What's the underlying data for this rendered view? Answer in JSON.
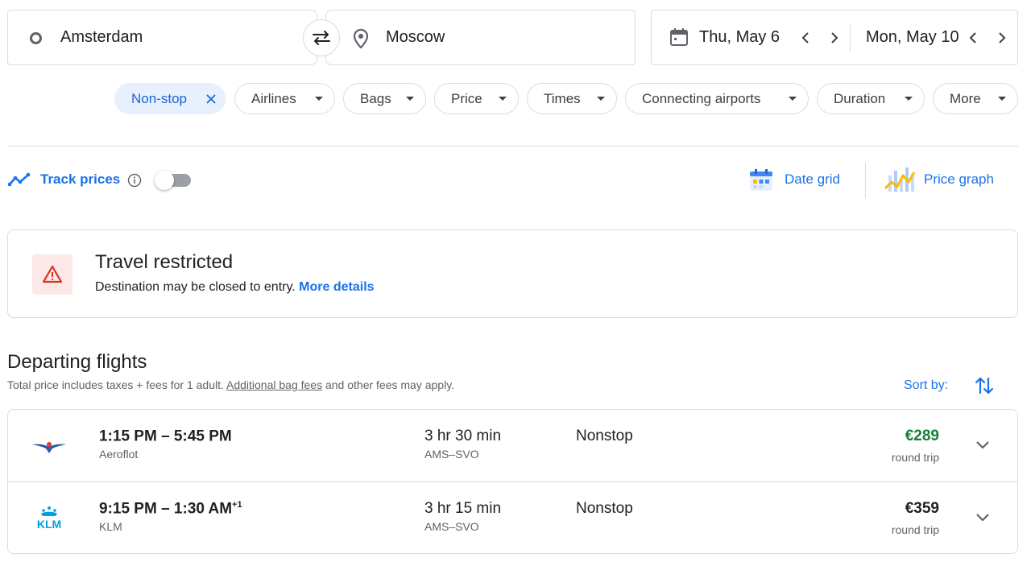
{
  "search": {
    "origin": "Amsterdam",
    "destination": "Moscow",
    "depart_date": "Thu, May 6",
    "return_date": "Mon, May 10"
  },
  "filters": [
    {
      "label": "Non-stop",
      "active": true
    },
    {
      "label": "Airlines"
    },
    {
      "label": "Bags"
    },
    {
      "label": "Price"
    },
    {
      "label": "Times"
    },
    {
      "label": "Connecting airports"
    },
    {
      "label": "Duration"
    },
    {
      "label": "More"
    }
  ],
  "tools": {
    "track_prices": "Track prices",
    "date_grid": "Date grid",
    "price_graph": "Price graph"
  },
  "restriction": {
    "title": "Travel restricted",
    "text": "Destination may be closed to entry.",
    "link": "More details"
  },
  "departing": {
    "title": "Departing flights",
    "note_prefix": "Total price includes taxes + fees for 1 adult.",
    "note_link": "Additional bag fees",
    "note_suffix": "and other fees may apply.",
    "sort_label": "Sort by:"
  },
  "flights": [
    {
      "time": "1:15 PM – 5:45 PM",
      "day_offset": "",
      "airline": "Aeroflot",
      "duration": "3 hr 30 min",
      "route": "AMS–SVO",
      "stops": "Nonstop",
      "price": "€289",
      "price_type": "round trip"
    },
    {
      "time": "9:15 PM – 1:30 AM",
      "day_offset": "+1",
      "airline": "KLM",
      "duration": "3 hr 15 min",
      "route": "AMS–SVO",
      "stops": "Nonstop",
      "price": "€359",
      "price_type": "round trip"
    }
  ],
  "colors": {
    "accent": "#1a73e8",
    "price_green": "#188038",
    "warning": "#d93025"
  }
}
